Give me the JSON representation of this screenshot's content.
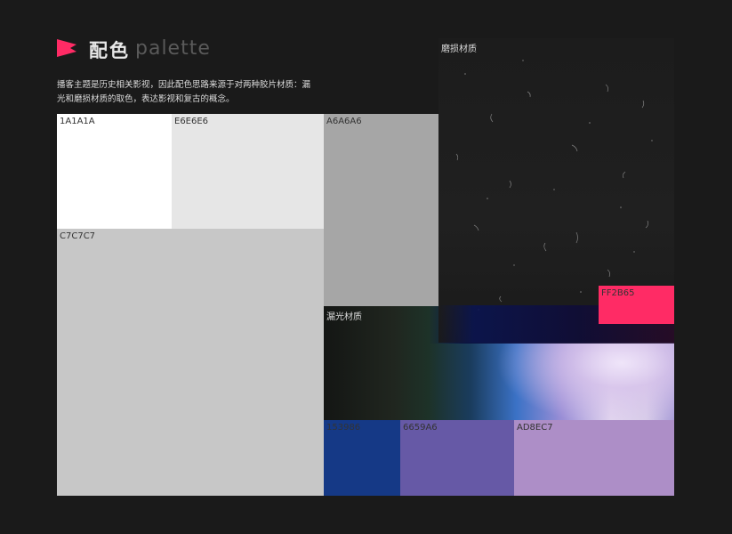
{
  "header": {
    "title_zh": "配色",
    "title_en": "palette",
    "accent": "#FF2B65"
  },
  "description": "播客主题是历史相关影视，因此配色思路来源于对两种胶片材质：漏光和磨损材质的取色，表达影视和复古的概念。",
  "swatches": [
    {
      "label": "1A1A1A",
      "color": "#FFFFFF"
    },
    {
      "label": "E6E6E6",
      "color": "#E6E6E6"
    },
    {
      "label": "A6A6A6",
      "color": "#A6A6A6"
    },
    {
      "label": "C7C7C7",
      "color": "#C7C7C7"
    },
    {
      "label": "FF2B65",
      "color": "#FF2B65"
    },
    {
      "label": "153986",
      "color": "#153986"
    },
    {
      "label": "6659A6",
      "color": "#6659A6"
    },
    {
      "label": "AD8EC7",
      "color": "#AD8EC7"
    }
  ],
  "textures": {
    "worn": "磨损材质",
    "light_leak": "漏光材质"
  }
}
